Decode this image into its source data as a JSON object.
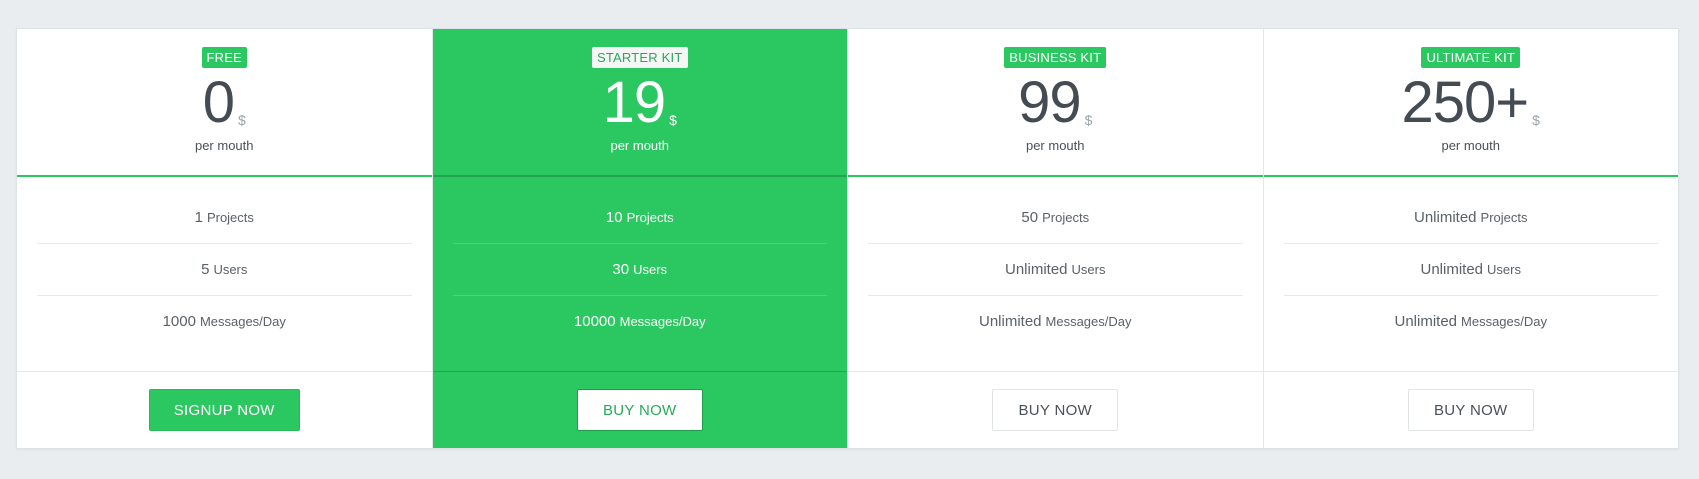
{
  "colors": {
    "accent": "#2bc760",
    "background": "#e9edf0",
    "text": "#444b52"
  },
  "plans": [
    {
      "badge": "FREE",
      "price": "0",
      "currency": "$",
      "period": "per mouth",
      "features": [
        {
          "value": "1",
          "unit": "Projects"
        },
        {
          "value": "5",
          "unit": "Users"
        },
        {
          "value": "1000",
          "unit": "Messages/Day"
        }
      ],
      "button": "SIGNUP NOW"
    },
    {
      "badge": "STARTER KIT",
      "price": "19",
      "currency": "$",
      "period": "per mouth",
      "features": [
        {
          "value": "10",
          "unit": "Projects"
        },
        {
          "value": "30",
          "unit": "Users"
        },
        {
          "value": "10000",
          "unit": "Messages/Day"
        }
      ],
      "button": "BUY NOW"
    },
    {
      "badge": "BUSINESS KIT",
      "price": "99",
      "currency": "$",
      "period": "per mouth",
      "features": [
        {
          "value": "50",
          "unit": "Projects"
        },
        {
          "value": "Unlimited",
          "unit": "Users"
        },
        {
          "value": "Unlimited",
          "unit": "Messages/Day"
        }
      ],
      "button": "BUY NOW"
    },
    {
      "badge": "ULTIMATE KIT",
      "price": "250+",
      "currency": "$",
      "period": "per mouth",
      "features": [
        {
          "value": "Unlimited",
          "unit": "Projects"
        },
        {
          "value": "Unlimited",
          "unit": "Users"
        },
        {
          "value": "Unlimited",
          "unit": "Messages/Day"
        }
      ],
      "button": "BUY NOW"
    }
  ]
}
